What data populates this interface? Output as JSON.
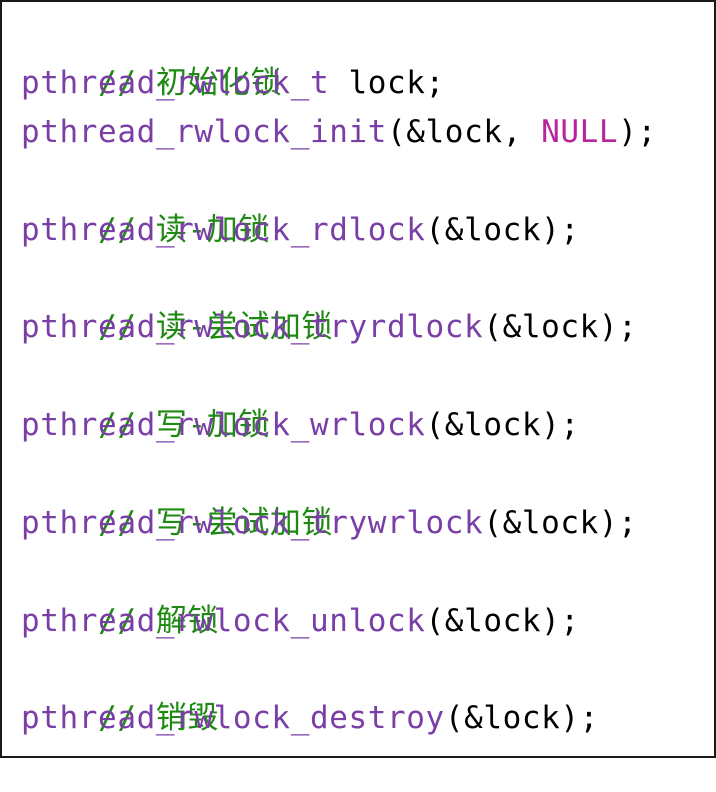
{
  "colors": {
    "comment": "#1f8a12",
    "function": "#7a3fa6",
    "plain": "#000000",
    "macro": "#b8259b",
    "border": "#1a1a1a"
  },
  "code": {
    "lines": [
      {
        "comment": "// 初始化锁"
      },
      {
        "fn": "pthread_rwlock_t",
        "plain": " lock;"
      },
      {
        "fn": "pthread_rwlock_init",
        "plain_before": "(&lock, ",
        "macro": "NULL",
        "plain_after": ");"
      },
      {
        "comment": "// 读-加锁"
      },
      {
        "fn": "pthread_rwlock_rdlock",
        "plain": "(&lock);"
      },
      {
        "comment": "// 读-尝试加锁"
      },
      {
        "fn": "pthread_rwlock_tryrdlock",
        "plain": "(&lock);"
      },
      {
        "comment": "// 写-加锁"
      },
      {
        "fn": "pthread_rwlock_wrlock",
        "plain": "(&lock);"
      },
      {
        "comment": "// 写-尝试加锁"
      },
      {
        "fn": "pthread_rwlock_trywrlock",
        "plain": "(&lock);"
      },
      {
        "comment": "// 解锁"
      },
      {
        "fn": "pthread_rwlock_unlock",
        "plain": "(&lock);"
      },
      {
        "comment": "// 销毁"
      },
      {
        "fn": "pthread_rwlock_destroy",
        "plain": "(&lock);"
      }
    ]
  }
}
